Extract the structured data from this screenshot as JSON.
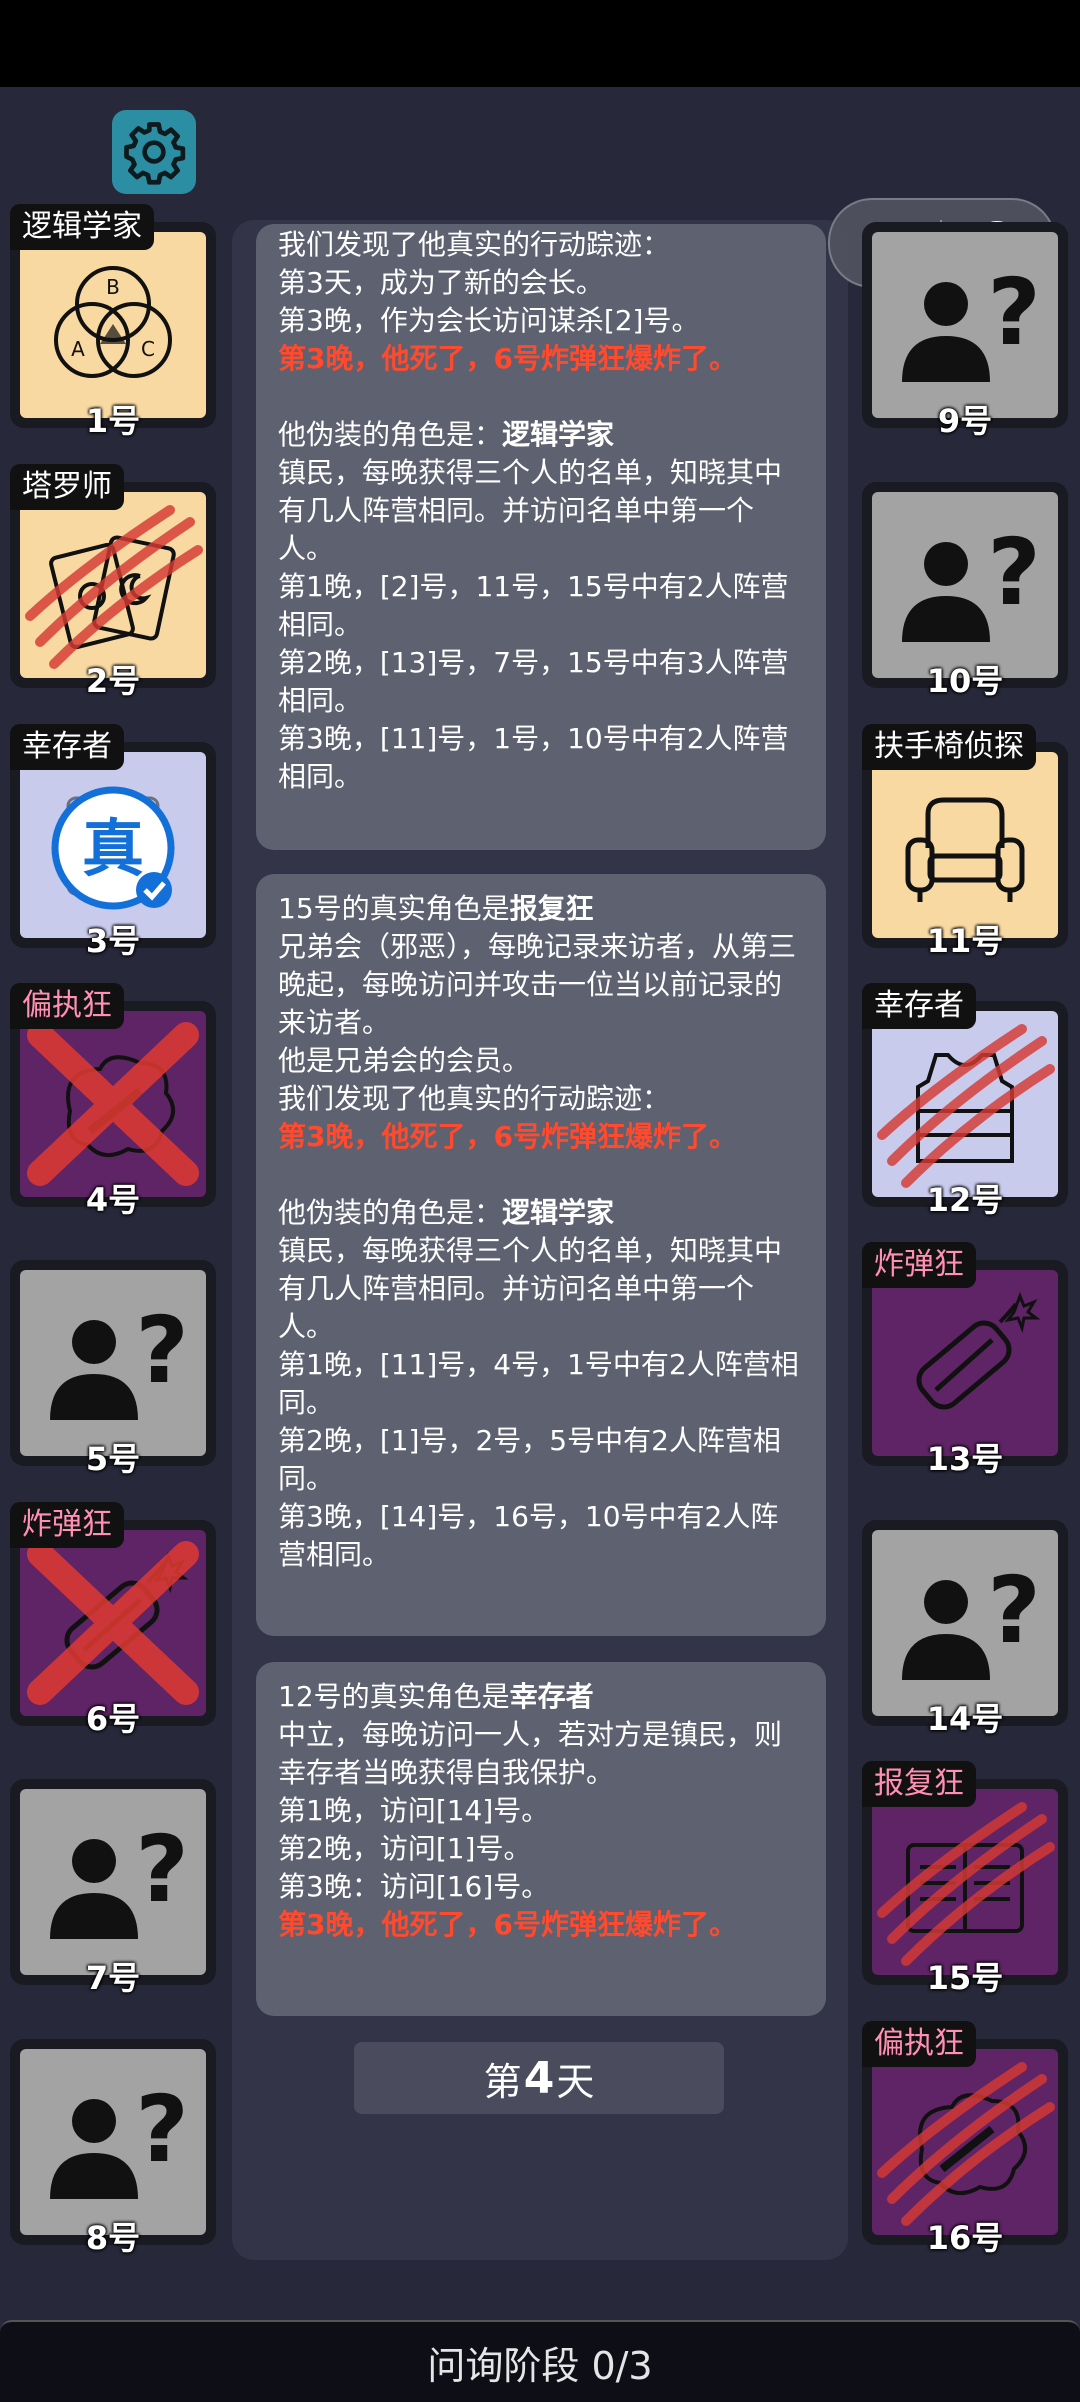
{
  "log": {
    "card1": {
      "lines": [
        {
          "t": "我们发现了他真实的行动踪迹：",
          "style": "normal"
        },
        {
          "t": "第3天，成为了新的会长。",
          "style": "normal"
        },
        {
          "t": "第3晚，作为会长访问谋杀[2]号。",
          "style": "normal"
        },
        {
          "t": "第3晚，他死了，6号炸弹狂爆炸了。",
          "style": "red"
        },
        {
          "t": "",
          "style": "gap"
        },
        {
          "t": "他伪装的角色是：",
          "bold": "逻辑学家",
          "style": "mixed"
        },
        {
          "t": "镇民，每晚获得三个人的名单，知晓其中有几人阵营相同。并访问名单中第一个人。",
          "style": "normal"
        },
        {
          "t": "第1晚，[2]号，11号，15号中有2人阵营相同。",
          "style": "normal"
        },
        {
          "t": "第2晚，[13]号，7号，15号中有3人阵营相同。",
          "style": "normal"
        },
        {
          "t": "第3晚，[11]号，1号，10号中有2人阵营相同。",
          "style": "normal"
        }
      ]
    },
    "card2": {
      "lines": [
        {
          "t": "15号的真实角色是",
          "bold": "报复狂",
          "style": "mixed"
        },
        {
          "t": "兄弟会（邪恶），每晚记录来访者，从第三晚起，每晚访问并攻击一位当以前记录的来访者。",
          "style": "normal"
        },
        {
          "t": "他是兄弟会的会员。",
          "style": "normal"
        },
        {
          "t": "我们发现了他真实的行动踪迹：",
          "style": "normal"
        },
        {
          "t": "第3晚，他死了，6号炸弹狂爆炸了。",
          "style": "red"
        },
        {
          "t": "",
          "style": "gap"
        },
        {
          "t": "他伪装的角色是：",
          "bold": "逻辑学家",
          "style": "mixed"
        },
        {
          "t": "镇民，每晚获得三个人的名单，知晓其中有几人阵营相同。并访问名单中第一个人。",
          "style": "normal"
        },
        {
          "t": "第1晚，[11]号，4号，1号中有2人阵营相同。",
          "style": "normal"
        },
        {
          "t": "第2晚，[1]号，2号，5号中有2人阵营相同。",
          "style": "normal"
        },
        {
          "t": "第3晚，[14]号，16号，10号中有2人阵营相同。",
          "style": "normal"
        }
      ]
    },
    "card3": {
      "lines": [
        {
          "t": "12号的真实角色是",
          "bold": "幸存者",
          "style": "mixed"
        },
        {
          "t": "中立，每晚访问一人，若对方是镇民，则幸存者当晚获得自我保护。",
          "style": "normal"
        },
        {
          "t": "第1晚，访问[14]号。",
          "style": "normal"
        },
        {
          "t": "第2晚，访问[1]号。",
          "style": "normal"
        },
        {
          "t": "第3晚：访问[16]号。",
          "style": "normal"
        },
        {
          "t": "第3晚，他死了，6号炸弹狂爆炸了。",
          "style": "red"
        }
      ]
    }
  },
  "day": {
    "prefix": "第",
    "number": "4",
    "suffix": "天"
  },
  "phase": {
    "label": "问询阶段 0/3"
  },
  "players": [
    {
      "id": 1,
      "label": "1号",
      "role": "逻辑学家",
      "faction": "town",
      "icon": "venn-diagram-icon",
      "bg": "#f8d9a2",
      "dead": false,
      "crossed": false
    },
    {
      "id": 2,
      "label": "2号",
      "role": "塔罗师",
      "faction": "town",
      "icon": "tarot-cards-icon",
      "bg": "#f8d9a2",
      "dead": true,
      "crossed": false
    },
    {
      "id": 3,
      "label": "3号",
      "role": "幸存者",
      "faction": "neutral",
      "icon": "verified-stamp-icon",
      "bg": "#c9cbec",
      "dead": false,
      "crossed": false
    },
    {
      "id": 4,
      "label": "4号",
      "role": "偏执狂",
      "faction": "evil",
      "icon": "paranoid-icon",
      "bg": "#5f2466",
      "dead": false,
      "crossed": true
    },
    {
      "id": 5,
      "label": "5号",
      "role": "",
      "faction": "unknown",
      "icon": "unknown-person-icon",
      "bg": "#a3a3a3",
      "dead": false,
      "crossed": false
    },
    {
      "id": 6,
      "label": "6号",
      "role": "炸弹狂",
      "faction": "evil",
      "icon": "bomb-icon",
      "bg": "#5f2466",
      "dead": false,
      "crossed": true
    },
    {
      "id": 7,
      "label": "7号",
      "role": "",
      "faction": "unknown",
      "icon": "unknown-person-icon",
      "bg": "#a3a3a3",
      "dead": false,
      "crossed": false
    },
    {
      "id": 8,
      "label": "8号",
      "role": "",
      "faction": "unknown",
      "icon": "unknown-person-icon",
      "bg": "#a3a3a3",
      "dead": false,
      "crossed": false
    },
    {
      "id": 9,
      "label": "9号",
      "role": "",
      "faction": "unknown",
      "icon": "unknown-person-icon",
      "bg": "#a3a3a3",
      "dead": false,
      "crossed": false
    },
    {
      "id": 10,
      "label": "10号",
      "role": "",
      "faction": "unknown",
      "icon": "unknown-person-icon",
      "bg": "#a3a3a3",
      "dead": false,
      "crossed": false
    },
    {
      "id": 11,
      "label": "11号",
      "role": "扶手椅侦探",
      "faction": "town",
      "icon": "armchair-icon",
      "bg": "#f8d9a2",
      "dead": false,
      "crossed": false
    },
    {
      "id": 12,
      "label": "12号",
      "role": "幸存者",
      "faction": "neutral",
      "icon": "vest-icon",
      "bg": "#c9cbec",
      "dead": true,
      "crossed": false
    },
    {
      "id": 13,
      "label": "13号",
      "role": "炸弹狂",
      "faction": "evil",
      "icon": "bomb-icon",
      "bg": "#5f2466",
      "dead": false,
      "crossed": false
    },
    {
      "id": 14,
      "label": "14号",
      "role": "",
      "faction": "unknown",
      "icon": "unknown-person-icon",
      "bg": "#a3a3a3",
      "dead": false,
      "crossed": false
    },
    {
      "id": 15,
      "label": "15号",
      "role": "报复狂",
      "faction": "evil",
      "icon": "notebook-icon",
      "bg": "#5f2466",
      "dead": true,
      "crossed": false
    },
    {
      "id": 16,
      "label": "16号",
      "role": "偏执狂",
      "faction": "evil",
      "icon": "paranoid-icon",
      "bg": "#5f2466",
      "dead": true,
      "crossed": false
    }
  ],
  "colors": {
    "background": "#27283a",
    "panel": "#333447",
    "card": "#5e6170",
    "death_text": "#ff4a2e",
    "evil_tag": "#ff8fb3",
    "settings": "#2c8ea2"
  }
}
